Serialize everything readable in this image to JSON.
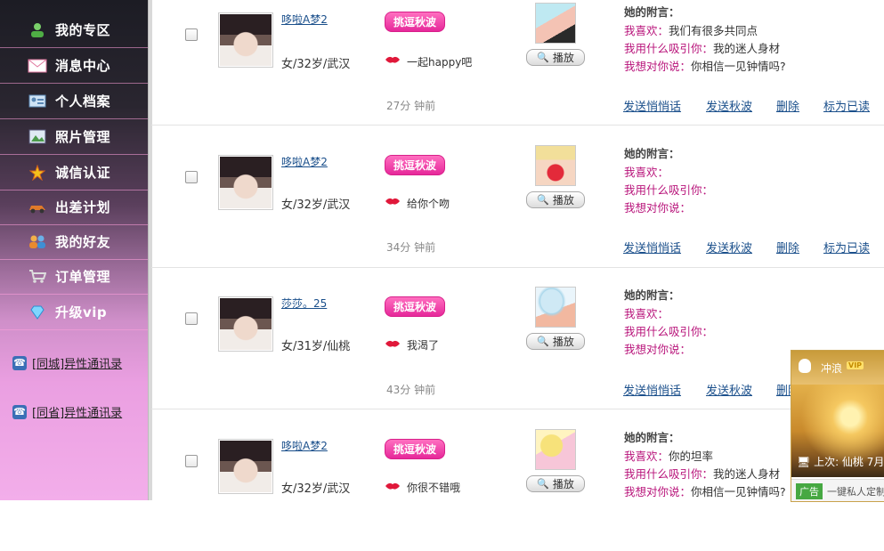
{
  "sidebar": {
    "items": [
      {
        "label": "我的专区",
        "icon": "user-icon"
      },
      {
        "label": "消息中心",
        "icon": "envelope-icon"
      },
      {
        "label": "个人档案",
        "icon": "id-card-icon"
      },
      {
        "label": "照片管理",
        "icon": "photo-icon"
      },
      {
        "label": "诚信认证",
        "icon": "star-badge-icon"
      },
      {
        "label": "出差计划",
        "icon": "car-icon"
      },
      {
        "label": "我的好友",
        "icon": "friends-icon"
      },
      {
        "label": "订单管理",
        "icon": "cart-icon"
      },
      {
        "label": "升级vip",
        "icon": "diamond-icon"
      }
    ],
    "links": [
      {
        "label": "[同城]异性通讯录",
        "icon": "contacts-icon"
      },
      {
        "label": "[同省]异性通讯录",
        "icon": "contacts-icon"
      }
    ]
  },
  "labels": {
    "badge": "挑逗秋波",
    "play": "播放",
    "note_title": "她的附言：",
    "like": "我喜欢：",
    "attract": "我用什么吸引你：",
    "say": "我想对你说："
  },
  "actions": {
    "send_whisper": "发送悄悄话",
    "send_wink": "发送秋波",
    "delete": "删除",
    "mark_read": "标为已读"
  },
  "messages": [
    {
      "name": "哆啦A梦2",
      "info": "女/32岁/武汉",
      "text": "一起happy吧",
      "time": "27分 钟前",
      "like": "我们有很多共同点",
      "attract": "我的迷人身材",
      "say": "你相信一见钟情吗?"
    },
    {
      "name": "哆啦A梦2",
      "info": "女/32岁/武汉",
      "text": "给你个吻",
      "time": "34分 钟前",
      "like": "",
      "attract": "",
      "say": ""
    },
    {
      "name": "莎莎。25",
      "info": "女/31岁/仙桃",
      "text": "我渴了",
      "time": "43分 钟前",
      "like": "",
      "attract": "",
      "say": ""
    },
    {
      "name": "哆啦A梦2",
      "info": "女/32岁/武汉",
      "text": "你很不错哦",
      "time": "",
      "like": "你的坦率",
      "attract": "我的迷人身材",
      "say": "你相信一见钟情吗?"
    }
  ],
  "popup": {
    "brand": "冲浪",
    "vip": "VIP",
    "last_login": "上次: 仙桃  7月",
    "ad_badge": "广告",
    "ad_text": "一键私人定制"
  },
  "colors": {
    "accent_pink": "#e6289a",
    "link_blue": "#1a4f8b",
    "note_key": "#b8137a"
  }
}
